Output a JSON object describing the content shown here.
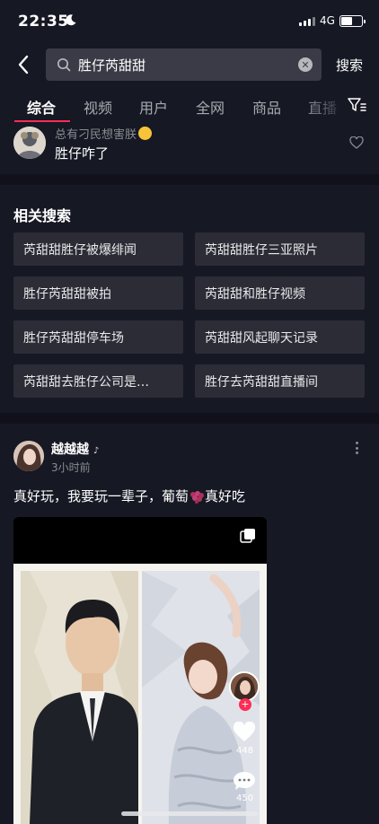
{
  "status_bar": {
    "time": "22:35",
    "network": "4G"
  },
  "search": {
    "query": "胜仔芮甜甜",
    "submit_label": "搜索"
  },
  "tabs": [
    {
      "label": "综合",
      "active": true
    },
    {
      "label": "视频"
    },
    {
      "label": "用户"
    },
    {
      "label": "全网"
    },
    {
      "label": "商品"
    },
    {
      "label": "直播"
    }
  ],
  "first_result": {
    "username": "总有刁民想害朕",
    "text": "胜仔咋了"
  },
  "related": {
    "title": "相关搜索",
    "items": [
      "芮甜甜胜仔被爆绯闻",
      "芮甜甜胜仔三亚照片",
      "胜仔芮甜甜被拍",
      "芮甜甜和胜仔视频",
      "胜仔芮甜甜停车场",
      "芮甜甜风起聊天记录",
      "芮甜甜去胜仔公司是…",
      "胜仔去芮甜甜直播间"
    ]
  },
  "post": {
    "username": "越越越",
    "time": "3小时前",
    "text_before": "真好玩，我要玩一辈子，葡萄",
    "text_after": "真好吃",
    "likes": "448",
    "comments": "450"
  },
  "colors": {
    "accent": "#fe2c55",
    "background": "#161823",
    "chip": "#2b2c36"
  }
}
